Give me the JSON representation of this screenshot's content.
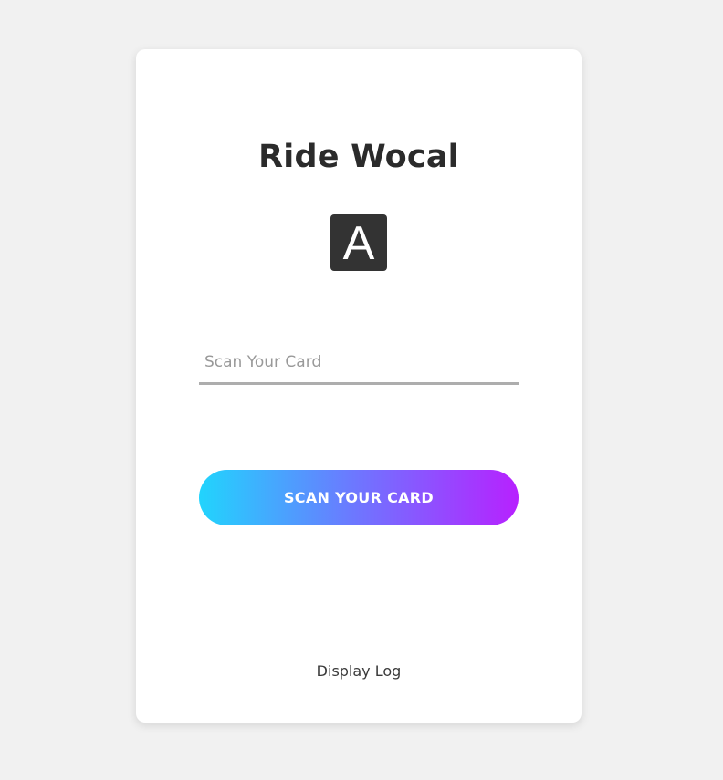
{
  "app": {
    "title": "Ride Wocal",
    "logo_letter": "A",
    "logo_icon": "letter-a-logo-icon"
  },
  "form": {
    "card_input": {
      "value": "",
      "placeholder": "Scan Your Card"
    },
    "scan_button_label": "SCAN YOUR CARD"
  },
  "footer": {
    "display_log_label": "Display Log"
  },
  "colors": {
    "background": "#f1f1f1",
    "card": "#ffffff",
    "title": "#2b2b2b",
    "logo_bg": "#333333",
    "input_underline": "#adadad",
    "button_gradient_start": "#21d4fd",
    "button_gradient_end": "#b721ff"
  }
}
